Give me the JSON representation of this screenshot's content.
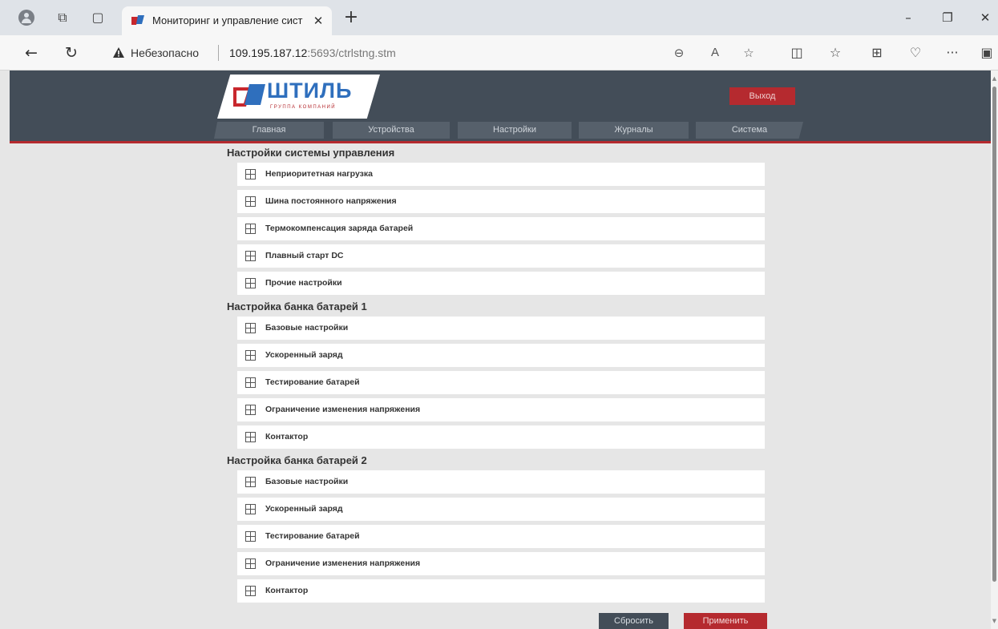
{
  "browser": {
    "tab_title": "Мониторинг и управление сист",
    "insecure_label": "Небезопасно",
    "url_main": "109.195.187.12",
    "url_rest": ":5693/ctrlstng.stm",
    "zoom_icon": "zoom-out-icon",
    "read_aloud_label": "A",
    "more_label": "···"
  },
  "site": {
    "logo_text": "ШТИЛЬ",
    "logo_subtext": "ГРУППА КОМПАНИЙ",
    "logout_label": "Выход",
    "nav": [
      "Главная",
      "Устройства",
      "Настройки",
      "Журналы",
      "Система"
    ]
  },
  "sections": [
    {
      "title": "Настройки системы управления",
      "items": [
        "Неприоритетная нагрузка",
        "Шина постоянного напряжения",
        "Термокомпенсация заряда батарей",
        "Плавный старт DC",
        "Прочие настройки"
      ]
    },
    {
      "title": "Настройка банка батарей 1",
      "items": [
        "Базовые настройки",
        "Ускоренный заряд",
        "Тестирование батарей",
        "Ограничение изменения напряжения",
        "Контактор"
      ]
    },
    {
      "title": "Настройка банка батарей 2",
      "items": [
        "Базовые настройки",
        "Ускоренный заряд",
        "Тестирование батарей",
        "Ограничение изменения напряжения",
        "Контактор"
      ]
    }
  ],
  "actions": {
    "reset_label": "Сбросить",
    "apply_label": "Применить"
  },
  "colors": {
    "header_bg": "#434d58",
    "accent_red": "#b52a2f",
    "page_bg": "#e6e6e6"
  }
}
